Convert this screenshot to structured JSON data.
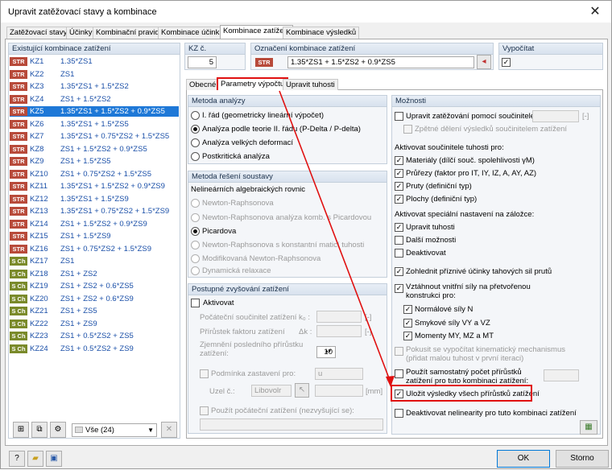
{
  "title": "Upravit zatěžovací stavy a kombinace",
  "tabs": [
    "Zatěžovací stavy",
    "Účinky",
    "Kombinační pravidla",
    "Kombinace účinků",
    "Kombinace zatížení",
    "Kombinace výsledků"
  ],
  "left_panel": {
    "header": "Existující kombinace zatížení",
    "rows": [
      {
        "badge": "STR",
        "kz": "KZ1",
        "desc": "1.35*ZS1"
      },
      {
        "badge": "STR",
        "kz": "KZ2",
        "desc": "ZS1"
      },
      {
        "badge": "STR",
        "kz": "KZ3",
        "desc": "1.35*ZS1 + 1.5*ZS2"
      },
      {
        "badge": "STR",
        "kz": "KZ4",
        "desc": "ZS1 + 1.5*ZS2"
      },
      {
        "badge": "STR",
        "kz": "KZ5",
        "desc": "1.35*ZS1 + 1.5*ZS2 + 0.9*ZS5"
      },
      {
        "badge": "STR",
        "kz": "KZ6",
        "desc": "1.35*ZS1 + 1.5*ZS5"
      },
      {
        "badge": "STR",
        "kz": "KZ7",
        "desc": "1.35*ZS1 + 0.75*ZS2 + 1.5*ZS5"
      },
      {
        "badge": "STR",
        "kz": "KZ8",
        "desc": "ZS1 + 1.5*ZS2 + 0.9*ZS5"
      },
      {
        "badge": "STR",
        "kz": "KZ9",
        "desc": "ZS1 + 1.5*ZS5"
      },
      {
        "badge": "STR",
        "kz": "KZ10",
        "desc": "ZS1 + 0.75*ZS2 + 1.5*ZS5"
      },
      {
        "badge": "STR",
        "kz": "KZ11",
        "desc": "1.35*ZS1 + 1.5*ZS2 + 0.9*ZS9"
      },
      {
        "badge": "STR",
        "kz": "KZ12",
        "desc": "1.35*ZS1 + 1.5*ZS9"
      },
      {
        "badge": "STR",
        "kz": "KZ13",
        "desc": "1.35*ZS1 + 0.75*ZS2 + 1.5*ZS9"
      },
      {
        "badge": "STR",
        "kz": "KZ14",
        "desc": "ZS1 + 1.5*ZS2 + 0.9*ZS9"
      },
      {
        "badge": "STR",
        "kz": "KZ15",
        "desc": "ZS1 + 1.5*ZS9"
      },
      {
        "badge": "STR",
        "kz": "KZ16",
        "desc": "ZS1 + 0.75*ZS2 + 1.5*ZS9"
      },
      {
        "badge": "S Ch",
        "kz": "KZ17",
        "desc": "ZS1"
      },
      {
        "badge": "S Ch",
        "kz": "KZ18",
        "desc": "ZS1 + ZS2"
      },
      {
        "badge": "S Ch",
        "kz": "KZ19",
        "desc": "ZS1 + ZS2 + 0.6*ZS5"
      },
      {
        "badge": "S Ch",
        "kz": "KZ20",
        "desc": "ZS1 + ZS2 + 0.6*ZS9"
      },
      {
        "badge": "S Ch",
        "kz": "KZ21",
        "desc": "ZS1 + ZS5"
      },
      {
        "badge": "S Ch",
        "kz": "KZ22",
        "desc": "ZS1 + ZS9"
      },
      {
        "badge": "S Ch",
        "kz": "KZ23",
        "desc": "ZS1 + 0.5*ZS2 + ZS5"
      },
      {
        "badge": "S Ch",
        "kz": "KZ24",
        "desc": "ZS1 + 0.5*ZS2 + ZS9"
      }
    ],
    "filter_value": "Vše (24)"
  },
  "kz": {
    "label": "KZ č.",
    "value": "5"
  },
  "oznaceni": {
    "label": "Označení kombinace zatížení",
    "badge": "STR",
    "value": "1.35*ZS1 + 1.5*ZS2 + 0.9*ZS5"
  },
  "vypocitat": {
    "label": "Vypočítat",
    "check": "✓"
  },
  "subtabs": [
    "Obecné",
    "Parametry výpočtu",
    "Upravit tuhosti"
  ],
  "metoda_analyzy": {
    "header": "Metoda analýzy",
    "options": [
      "I. řád (geometricky lineární výpočet)",
      "Analýza podle teorie II. řádu (P-Delta / P-delta)",
      "Analýza velkých deformací",
      "Postkritická analýza"
    ]
  },
  "metoda_reseni": {
    "header": "Metoda řešení soustavy",
    "sub": "Nelineárních algebraických rovnic",
    "options": [
      "Newton-Raphsonova",
      "Newton-Raphsonova analýza komb. s Picardovou",
      "Picardova",
      "Newton-Raphsonova s konstantní maticí tuhosti",
      "Modifikovaná Newton-Raphsonova",
      "Dynamická relaxace"
    ]
  },
  "postupne": {
    "header": "Postupné zvyšování zatížení",
    "aktivovat": "Aktivovat",
    "pocatecni": "Počáteční součinitel zatížení",
    "pocatecni_unit": "k₀ :",
    "prirustek": "Přírůstek faktoru zatížení",
    "prirustek_unit": "Δk :",
    "zjemneni": "Zjemnění posledního přírůstku zatížení:",
    "zjemneni_value": "10",
    "podminka": "Podmínka zastavení pro:",
    "podminka_value": "u",
    "uzel": "Uzel č.:",
    "uzel_value": "Libovolr",
    "mm": "[mm]",
    "dash": "[-]",
    "pouzit": "Použít počáteční zatížení (nezvyšující se):"
  },
  "moznosti": {
    "header": "Možnosti",
    "upravit": "Upravit zatěžování pomocí součinitele:",
    "dash": "[-]",
    "zpetne": "Zpětné dělení výsledků součinitelem zatížení",
    "aktivovat_souc": "Aktivovat součinitele tuhosti pro:",
    "materialy": "Materiály (dílčí souč. spolehlivosti γM)",
    "prurezy": "Průřezy (faktor pro IT, IY, IZ, A, AY, AZ)",
    "pruty": "Pruty (definiční typ)",
    "plochy": "Plochy (definiční typ)",
    "aktivovat_spec": "Aktivovat speciální nastavení na záložce:",
    "upravit_tuhosti": "Upravit tuhosti",
    "dalsi": "Další možnosti",
    "deaktivovat": "Deaktivovat",
    "zohlednit": "Zohlednit příznivé účinky tahových sil prutů",
    "vztahnout": "Vztáhnout vnitřní síly na přetvořenou konstrukci pro:",
    "normalove": "Normálové síly N",
    "smykove": "Smykové síly VY a VZ",
    "momenty": "Momenty MY, MZ a MT",
    "pokusit": "Pokusit se vypočítat kinematický mechanismus (přidat malou tuhost v první iteraci)",
    "pouzit_samost": "Použít samostatný počet přírůstků zatížení pro tuto kombinaci zatížení:",
    "ulozit": "Uložit výsledky všech přírůstků zatížení",
    "deaktivovat_nel": "Deaktivovat nelinearity pro tuto kombinaci zatížení"
  },
  "footer": {
    "ok": "OK",
    "storno": "Storno"
  }
}
